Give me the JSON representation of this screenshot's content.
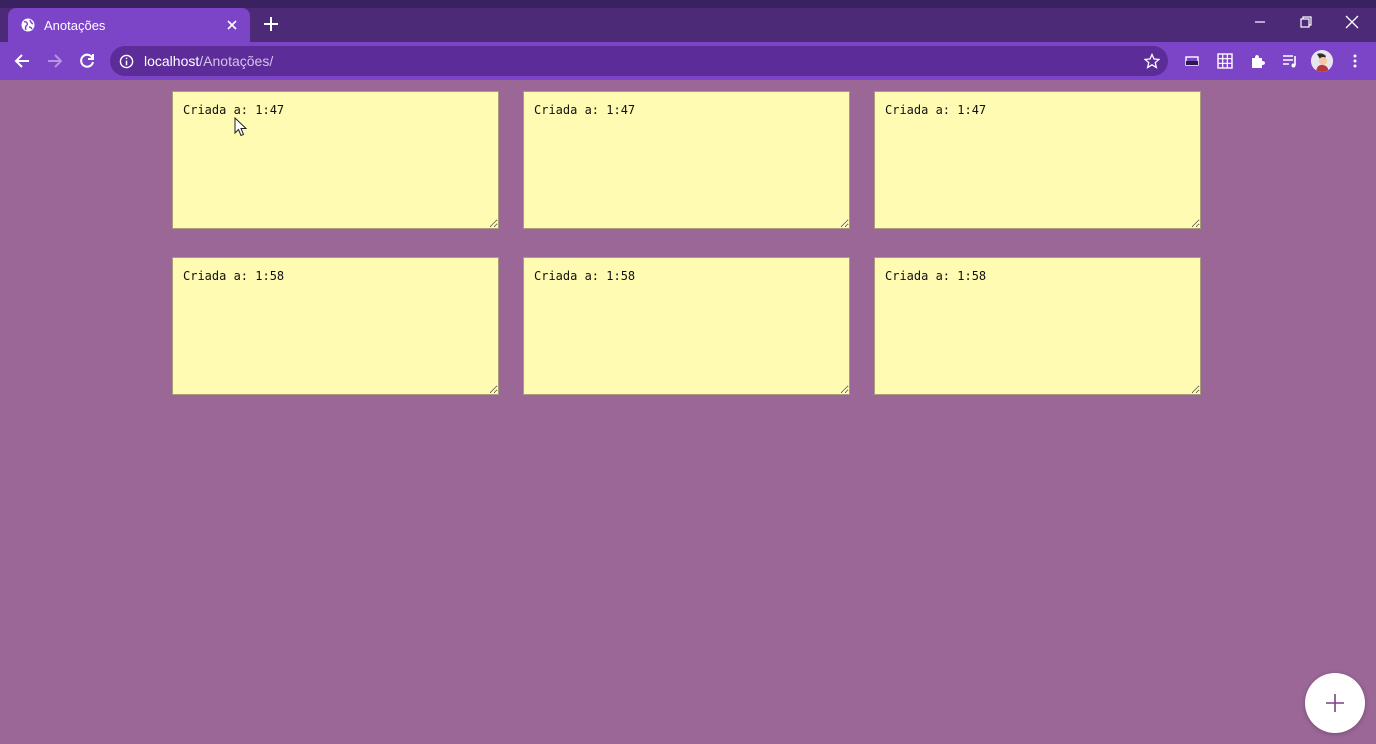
{
  "browser": {
    "tab_title": "Anotações",
    "url_host": "localhost",
    "url_path": "/Anotações/",
    "icons": [
      "globe-icon",
      "close-icon",
      "plus-icon",
      "minimize-icon",
      "restore-icon",
      "close-window-icon",
      "back-icon",
      "forward-icon",
      "reload-icon",
      "info-icon",
      "star-icon",
      "cast-icon",
      "grid-icon",
      "puzzle-icon",
      "media-icon",
      "avatar",
      "menu-icon"
    ]
  },
  "notes": [
    {
      "text": "Criada a: 1:47"
    },
    {
      "text": "Criada a: 1:47"
    },
    {
      "text": "Criada a: 1:47"
    },
    {
      "text": "Criada a: 1:58"
    },
    {
      "text": "Criada a: 1:58"
    },
    {
      "text": "Criada a: 1:58"
    }
  ],
  "colors": {
    "page_background": "#9a6796",
    "note_background": "#fffbb2",
    "chrome_accent": "#7c44c7"
  }
}
